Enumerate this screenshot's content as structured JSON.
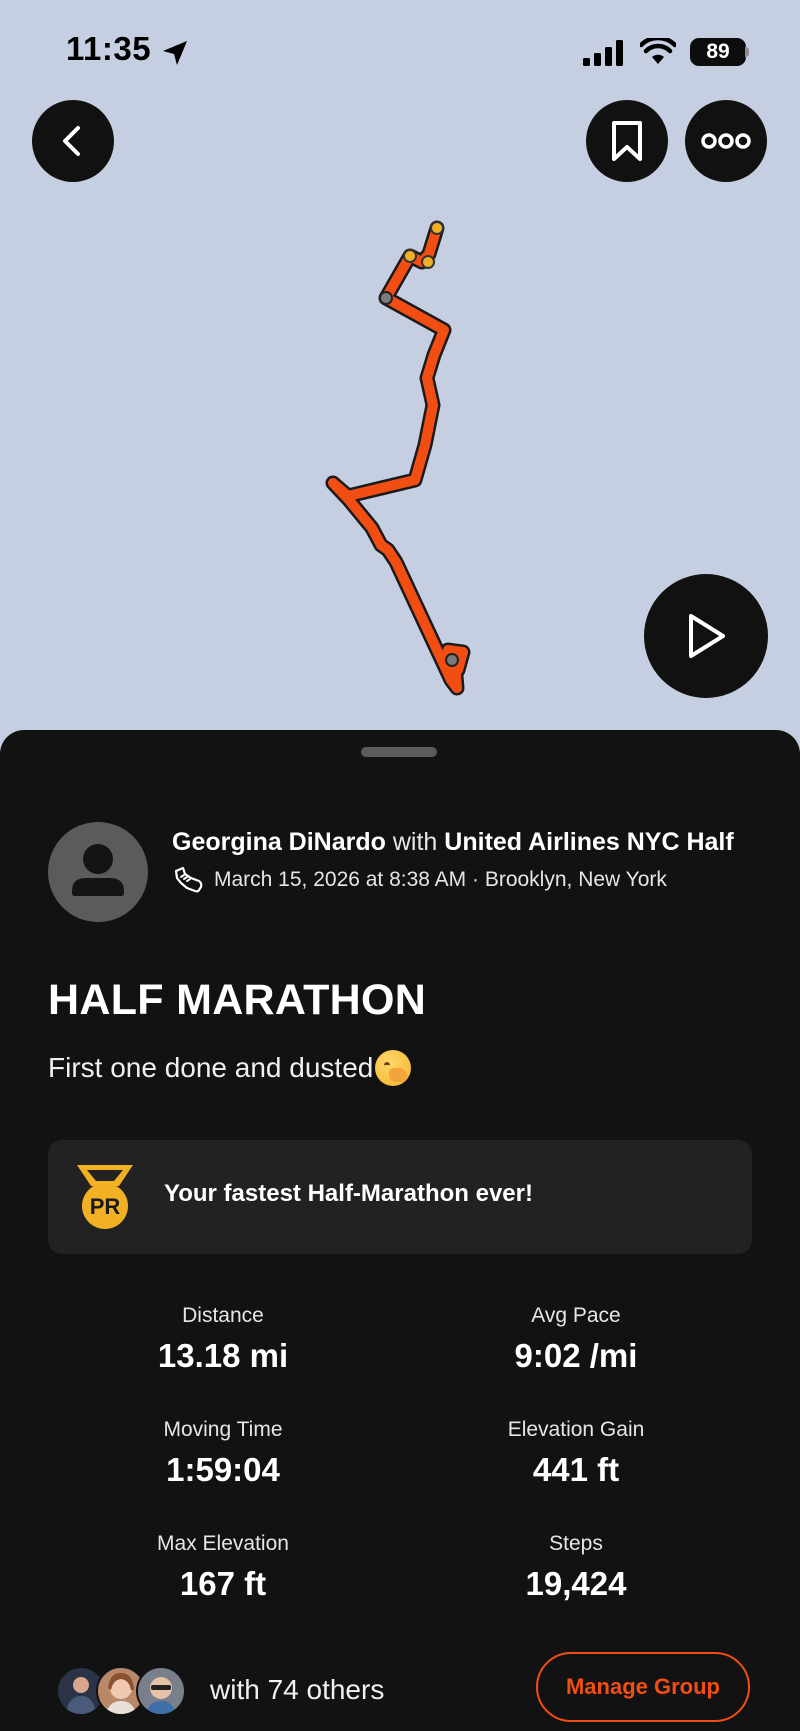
{
  "status_bar": {
    "time": "11:35",
    "battery": "89"
  },
  "map": {
    "route_color": "#f24e14",
    "background_color": "#c5cfe1"
  },
  "buttons": {
    "back_icon": "chevron-left-icon",
    "bookmark_icon": "bookmark-icon",
    "more_icon": "more-dots-icon",
    "play_icon": "play-icon"
  },
  "activity": {
    "athlete_name": "Georgina DiNardo",
    "with_text": "with",
    "event_name": "United Airlines NYC Half",
    "date_location": "March 15, 2026 at 8:38 AM · Brooklyn, New York",
    "title": "HALF MARATHON",
    "description": "First one done and dusted",
    "pr_badge": "PR",
    "pr_message": "Your fastest Half-Marathon ever!"
  },
  "stats": [
    {
      "label": "Distance",
      "value": "13.18 mi"
    },
    {
      "label": "Avg Pace",
      "value": "9:02 /mi"
    },
    {
      "label": "Moving Time",
      "value": "1:59:04"
    },
    {
      "label": "Elevation Gain",
      "value": "441 ft"
    },
    {
      "label": "Max Elevation",
      "value": "167 ft"
    },
    {
      "label": "Steps",
      "value": "19,424"
    }
  ],
  "group": {
    "others_text": "with 74 others",
    "manage_label": "Manage Group"
  },
  "colors": {
    "accent": "#f24e14",
    "sheet_bg": "#121212",
    "card_bg": "#222222"
  }
}
